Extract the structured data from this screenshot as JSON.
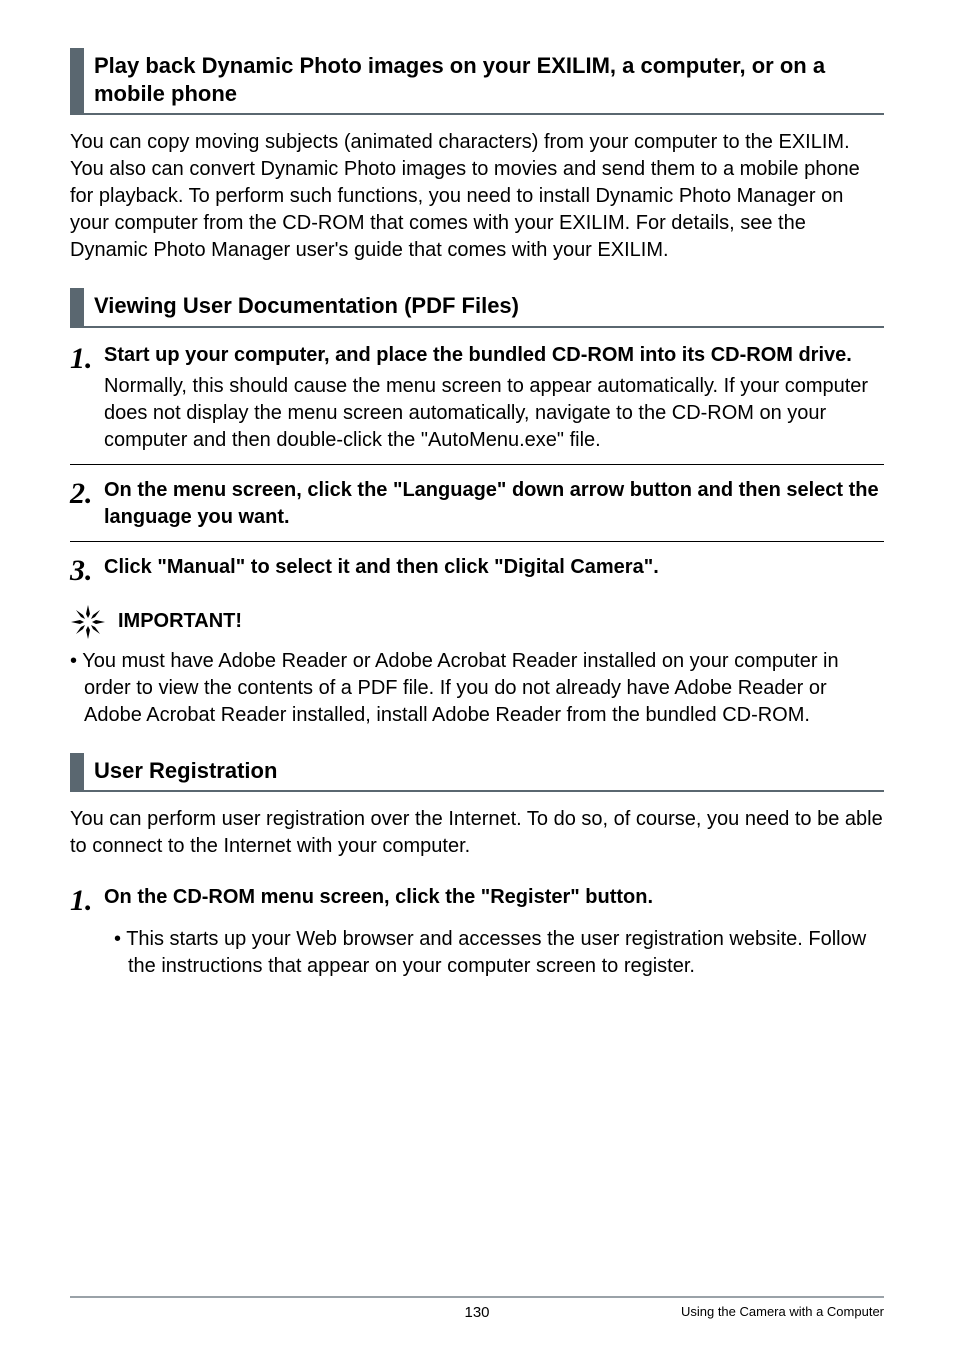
{
  "sections": {
    "s1": {
      "title": "Play back Dynamic Photo images on your EXILIM, a computer, or on a mobile phone",
      "body": "You can copy moving subjects (animated characters) from your computer to the EXILIM. You also can convert Dynamic Photo images to movies and send them to a mobile phone for playback. To perform such functions, you need to install Dynamic Photo Manager on your computer from the CD-ROM that comes with your EXILIM. For details, see the Dynamic Photo Manager user's guide that comes with your EXILIM."
    },
    "s2": {
      "title": "Viewing User Documentation (PDF Files)",
      "steps": {
        "st1": {
          "num": "1.",
          "title": "Start up your computer, and place the bundled CD-ROM into its CD-ROM drive.",
          "text": "Normally, this should cause the menu screen to appear automatically. If your computer does not display the menu screen automatically, navigate to the CD-ROM on your computer and then double-click the \"AutoMenu.exe\" file."
        },
        "st2": {
          "num": "2.",
          "title": "On the menu screen, click the \"Language\" down arrow button and then select the language you want."
        },
        "st3": {
          "num": "3.",
          "title": "Click \"Manual\" to select it and then click \"Digital Camera\"."
        }
      },
      "important": {
        "label": "IMPORTANT!",
        "bullet": "• You must have Adobe Reader or Adobe Acrobat Reader installed on your computer in order to view the contents of a PDF file. If you do not already have Adobe Reader or Adobe Acrobat Reader installed, install Adobe Reader from the bundled CD-ROM."
      }
    },
    "s3": {
      "title": "User Registration",
      "body": "You can perform user registration over the Internet. To do so, of course, you need to be able to connect to the Internet with your computer.",
      "step": {
        "num": "1.",
        "title": "On the CD-ROM menu screen, click the \"Register\" button.",
        "bullet": "• This starts up your Web browser and accesses the user registration website. Follow the instructions that appear on your computer screen to register."
      }
    }
  },
  "footer": {
    "page": "130",
    "right": "Using the Camera with a Computer"
  }
}
